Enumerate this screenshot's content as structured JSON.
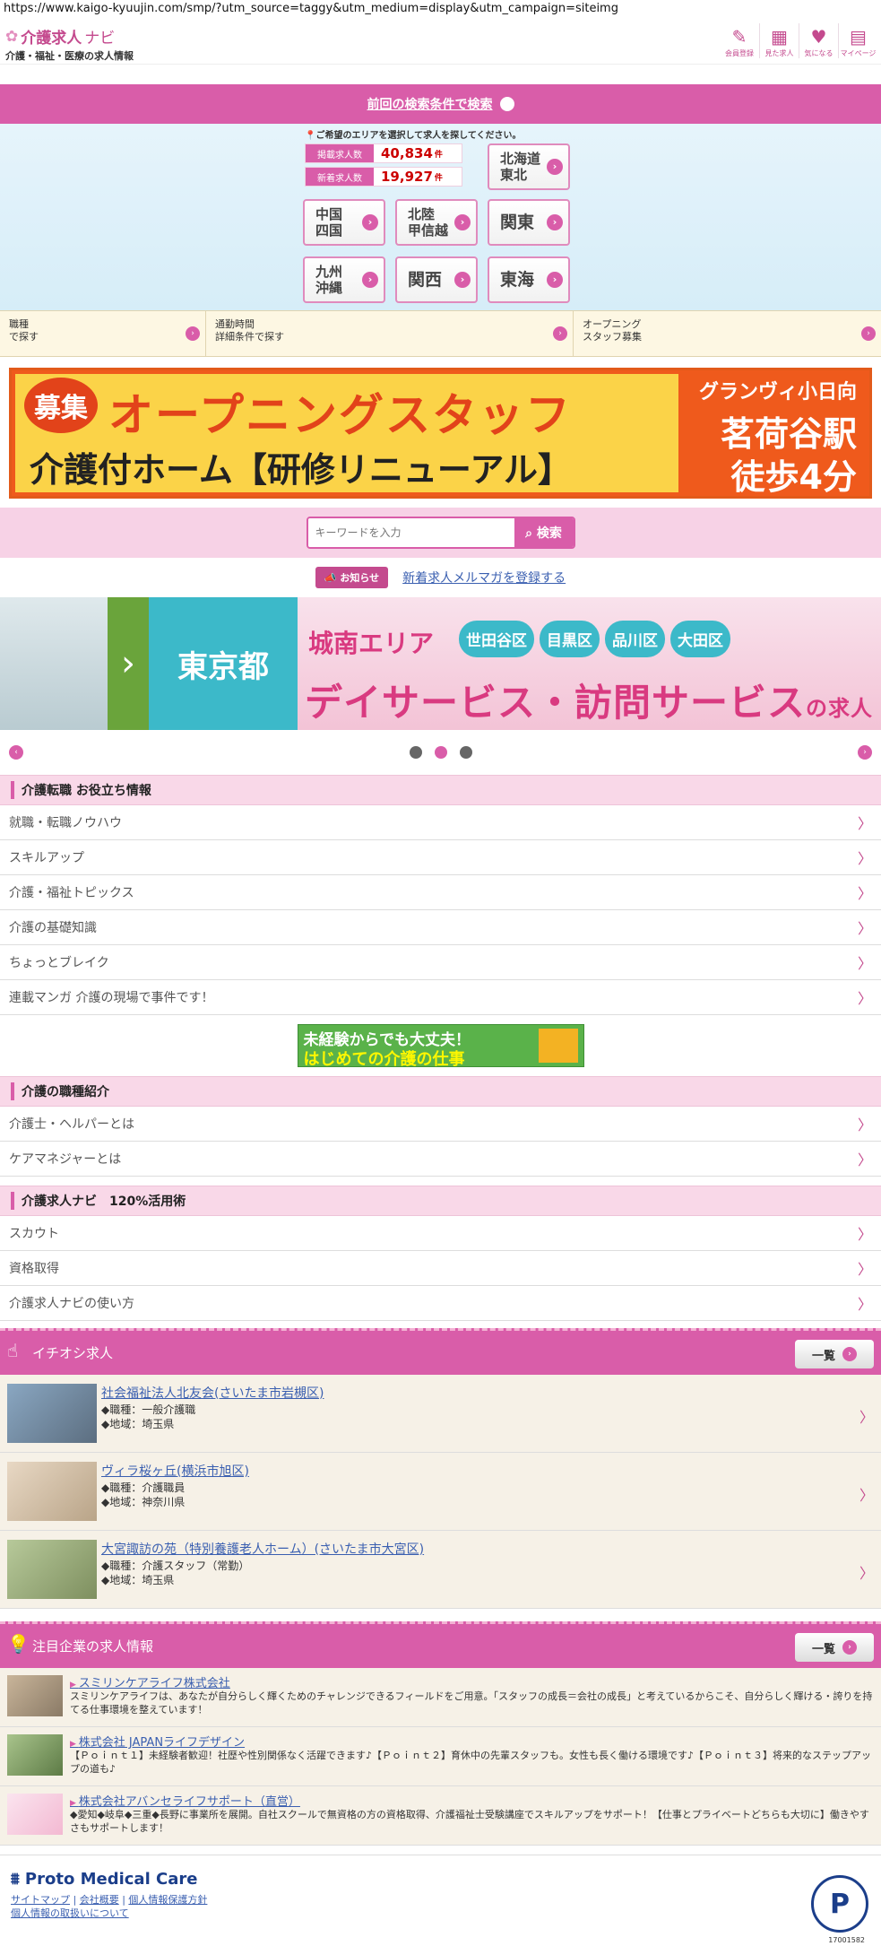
{
  "url": "https://www.kaigo-kyuujin.com/smp/?utm_source=taggy&utm_medium=display&utm_campaign=siteimg",
  "header": {
    "logo_main": "介護求人",
    "logo_navi": "ナビ",
    "logo_sub": "介護・福祉・医療の求人情報",
    "icons": [
      {
        "label": "会員登録",
        "icon": "pen-icon"
      },
      {
        "label": "見た求人",
        "icon": "calendar-icon"
      },
      {
        "label": "気になる",
        "icon": "heart-icon"
      },
      {
        "label": "マイページ",
        "icon": "mypage-icon"
      }
    ]
  },
  "prev_search": "前回の検索条件で検索",
  "area": {
    "message": "ご希望のエリアを選択して求人を探してください。",
    "count1_label": "掲載求人数",
    "count1": "40,834",
    "unit": "件",
    "count2_label": "新着求人数",
    "count2": "19,927",
    "regions": {
      "hokkaido": [
        "北海道",
        "東北"
      ],
      "chugoku": [
        "中国",
        "四国"
      ],
      "hokuriku": [
        "北陸",
        "甲信越"
      ],
      "kanto": "関東",
      "kyushu": [
        "九州",
        "沖縄"
      ],
      "kansai": "関西",
      "tokai": "東海"
    }
  },
  "search_options": [
    [
      "職種",
      "で探す"
    ],
    [
      "通勤時間",
      "詳細条件で探す"
    ],
    [
      "オープニング",
      "スタッフ募集"
    ]
  ],
  "banner1": {
    "boshu": "募集",
    "title": "オープニングスタッフ",
    "sub": "介護付ホーム【研修リニューアル】",
    "right1": "グランヴィ小日向",
    "right2": "茗荷谷駅",
    "right3": "徒歩4分"
  },
  "keyword": {
    "placeholder": "キーワードを入力",
    "button": "検索"
  },
  "news": {
    "tag": "お知らせ",
    "link": "新着求人メルマガを登録する"
  },
  "slider": {
    "pref": "東京都",
    "area": "城南エリア",
    "wards": [
      "世田谷区",
      "目黒区",
      "品川区",
      "大田区"
    ],
    "main": "デイサービス・訪問サービス",
    "suffix": "の求人"
  },
  "sections": {
    "info": {
      "title": "介護転職 お役立ち情報",
      "items": [
        "就職・転職ノウハウ",
        "スキルアップ",
        "介護・福祉トピックス",
        "介護の基礎知識",
        "ちょっとブレイク",
        "連載マンガ 介護の現場で事件です！"
      ]
    },
    "jobs": {
      "title": "介護の職種紹介",
      "items": [
        "介護士・ヘルパーとは",
        "ケアマネジャーとは"
      ]
    },
    "use": {
      "title": "介護求人ナビ　120%活用術",
      "items": [
        "スカウト",
        "資格取得",
        "介護求人ナビの使い方"
      ]
    }
  },
  "mid_banner": {
    "t1a": "未経験",
    "t1b": "からでも大丈夫！",
    "t2a": "はじめての",
    "t2b": "介護",
    "t2c": "の仕事"
  },
  "pickup": {
    "title": "イチオシ求人",
    "all": "一覧",
    "items": [
      {
        "name": "社会福祉法人北友会(さいたま市岩槻区)",
        "job": "◆職種：一般介護職",
        "area": "◆地域：埼玉県"
      },
      {
        "name": "ヴィラ桜ヶ丘(横浜市旭区)",
        "job": "◆職種：介護職員",
        "area": "◆地域：神奈川県"
      },
      {
        "name": "大宮諏訪の苑（特別養護老人ホーム）(さいたま市大宮区)",
        "job": "◆職種：介護スタッフ（常勤）",
        "area": "◆地域：埼玉県"
      }
    ]
  },
  "featured": {
    "title": "注目企業の求人情報",
    "all": "一覧",
    "items": [
      {
        "name": "スミリンケアライフ株式会社",
        "desc": "スミリンケアライフは、あなたが自分らしく輝くためのチャレンジできるフィールドをご用意。「スタッフの成長＝会社の成長」と考えているからこそ、自分らしく輝ける・誇りを持てる仕事環境を整えています！"
      },
      {
        "name": "株式会社 JAPANライフデザイン",
        "desc": "【Ｐｏｉｎｔ１】未経験者歓迎！社歴や性別関係なく活躍できます♪【Ｐｏｉｎｔ２】育休中の先輩スタッフも。女性も長く働ける環境です♪【Ｐｏｉｎｔ３】将来的なステップアップの道も♪"
      },
      {
        "name": "株式会社アバンセライフサポート（直営）",
        "desc": "◆愛知◆岐阜◆三重◆長野に事業所を展開。自社スクールで無資格の方の資格取得、介護福祉士受験講座でスキルアップをサポート！【仕事とプライベートどちらも大切に】働きやすさもサポートします！"
      }
    ]
  },
  "footer": {
    "brand": "Proto Medical Care",
    "links": [
      "サイトマップ",
      "会社概要",
      "個人情報保護方針",
      "個人情報の取扱いについて"
    ],
    "pmark_no": "17001582"
  }
}
